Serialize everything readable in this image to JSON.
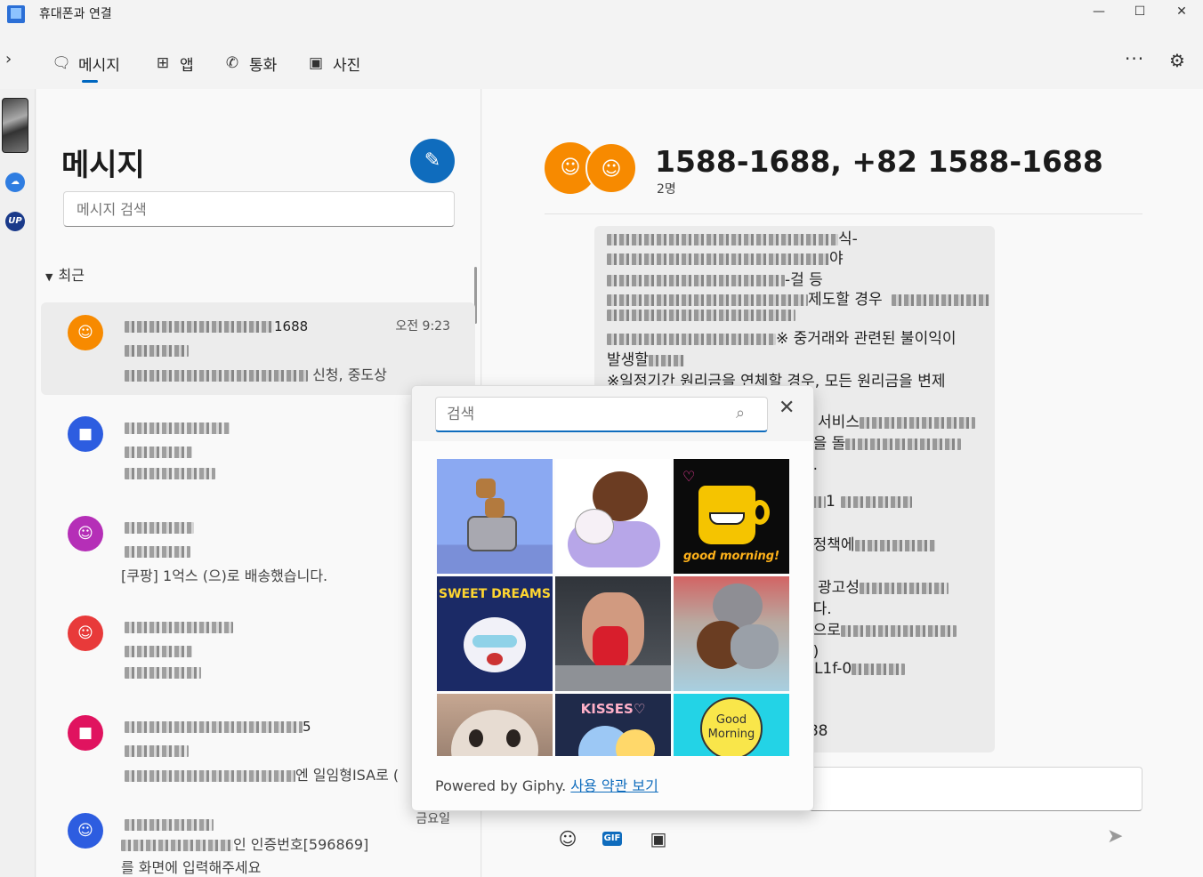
{
  "window": {
    "title": "휴대폰과 연결",
    "minimize": "—",
    "maximize": "☐",
    "close": "✕"
  },
  "nav": {
    "expand_icon": "chevron-right-icon",
    "tabs": [
      {
        "label": "메시지",
        "icon": "message-icon",
        "active": true
      },
      {
        "label": "앱",
        "icon": "apps-icon",
        "active": false
      },
      {
        "label": "통화",
        "icon": "phone-icon",
        "active": false
      },
      {
        "label": "사진",
        "icon": "photo-icon",
        "active": false
      }
    ],
    "more": "···",
    "settings_icon": "gear-icon"
  },
  "rail": {
    "items": [
      {
        "icon": "phone-thumbnail-icon"
      },
      {
        "icon": "cloud-icon",
        "color": "#2f7de1"
      },
      {
        "icon": "up-badge-icon",
        "label": "UP",
        "color": "#1a3a8a"
      }
    ]
  },
  "messages": {
    "title": "메시지",
    "compose_icon": "compose-icon",
    "search_placeholder": "메시지 검색",
    "section": "최근",
    "conversations": [
      {
        "name_tail": "1688",
        "time": "오전 9:23",
        "line2": "",
        "line3_tail": " 신청, 중도상",
        "avatar_color": "#f78a00",
        "selected": true
      },
      {
        "name_tail": "",
        "time": "",
        "line2": "",
        "line3_tail": "",
        "avatar_color": "#2d5de0",
        "selected": false
      },
      {
        "name_tail": "",
        "time": "",
        "line2": "",
        "line3_tail": "[쿠팡] 1억스 (으)로 배송했습니다.",
        "avatar_color": "#b52fb7",
        "selected": false
      },
      {
        "name_tail": "",
        "time": "",
        "line2": "",
        "line3_tail": "",
        "avatar_color": "#e83a3a",
        "selected": false
      },
      {
        "name_tail": "5",
        "time": "",
        "line2": "",
        "line3_tail": "엔 일임형ISA로 (",
        "avatar_color": "#e0135f",
        "selected": false
      },
      {
        "name_tail": "",
        "time": "금요일",
        "line2_tail": "인 인증번호[596869]",
        "line3_tail": "를 화면에 입력해주세요",
        "avatar_color": "#2d5de0",
        "selected": false
      }
    ]
  },
  "conversation": {
    "title": "1588-1688, +82 1588-1688",
    "subtitle": "2명",
    "bubble_lines": [
      "식-",
      "야",
      "-걸 등",
      "제도할 경우",
      "",
      "※ 중거래와 관련된 불이익이",
      "발생할",
      "※일정기간 원리금을 연체할 경우, 모든 원리금을 변제",
      "",
      "는 서비스",
      "행을 돌",
      "다.",
      "",
      "1",
      "",
      "업정책에",
      "",
      "드 광고성",
      "니다.",
      "들으로",
      "다)",
      "4-L1f-0",
      "",
      "",
      "688"
    ],
    "toolbar": {
      "emoji_icon": "emoji-icon",
      "gif_label": "GIF",
      "image_icon": "image-icon",
      "send_icon": "send-icon"
    }
  },
  "gif_picker": {
    "search_placeholder": "검색",
    "search_icon": "search-icon",
    "close_icon": "close-icon",
    "gifs": [
      {
        "name": "toaster-gif",
        "caption": ""
      },
      {
        "name": "bear-bunny-hug-gif",
        "caption": ""
      },
      {
        "name": "coffee-cup-gif",
        "caption": "good morning!"
      },
      {
        "name": "sweet-dreams-gif",
        "caption": "SWEET DREAMS"
      },
      {
        "name": "man-crying-gif",
        "caption": ""
      },
      {
        "name": "cat-teddy-gif",
        "caption": ""
      },
      {
        "name": "cat-closeup-gif",
        "caption": ""
      },
      {
        "name": "kisses-moon-gif",
        "caption": "KISSES♡"
      },
      {
        "name": "good-morning-gif",
        "caption": "Good Morning"
      }
    ],
    "powered_by": "Powered by Giphy.",
    "terms_link": "사용 약관 보기"
  }
}
